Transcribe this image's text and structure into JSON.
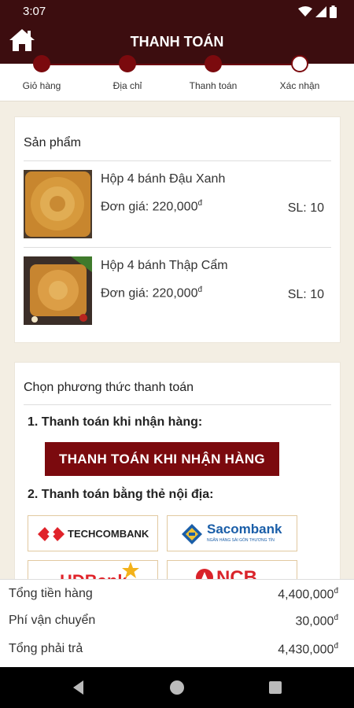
{
  "status": {
    "time": "3:07"
  },
  "header": {
    "title": "THANH TOÁN"
  },
  "steps": [
    {
      "label": "Giỏ hàng",
      "done": true
    },
    {
      "label": "Địa chỉ",
      "done": true
    },
    {
      "label": "Thanh toán",
      "done": true
    },
    {
      "label": "Xác nhận",
      "done": false
    }
  ],
  "products": {
    "title": "Sản phẩm",
    "items": [
      {
        "name": "Hộp 4 bánh Đậu Xanh",
        "price_label": "Đơn giá: 220,000",
        "currency": "đ",
        "qty": "SL: 10"
      },
      {
        "name": "Hộp 4 bánh Thập Cẩm",
        "price_label": "Đơn giá: 220,000",
        "currency": "đ",
        "qty": "SL: 10"
      }
    ]
  },
  "payment": {
    "title": "Chọn phương thức thanh toán",
    "cod_heading": "1. Thanh toán khi nhận hàng:",
    "cod_button": "THANH TOÁN KHI NHẬN HÀNG",
    "card_heading": "2. Thanh toán bằng thẻ nội địa:",
    "banks": [
      {
        "name": "TECHCOMBANK",
        "icon": "techcombank-logo",
        "color": "#e0232a"
      },
      {
        "name": "Sacombank",
        "icon": "sacombank-logo",
        "color": "#1a5ea8",
        "subtitle": "NGÂN HÀNG SÀI GÒN THƯƠNG TÍN"
      },
      {
        "name": "HDBank",
        "icon": "hdbank-logo",
        "color": "#e0232a"
      },
      {
        "name": "NCB",
        "icon": "ncb-logo",
        "color": "#d9232a"
      }
    ]
  },
  "summary": {
    "subtotal_label": "Tổng tiền hàng",
    "subtotal": "4,400,000",
    "shipping_label": "Phí vận chuyển",
    "shipping": "30,000",
    "total_label": "Tổng phải trả",
    "total": "4,430,000",
    "currency": "đ"
  },
  "colors": {
    "primary": "#7b0a0e",
    "header_bg": "#3c0d0f",
    "background": "#f3eee3"
  }
}
